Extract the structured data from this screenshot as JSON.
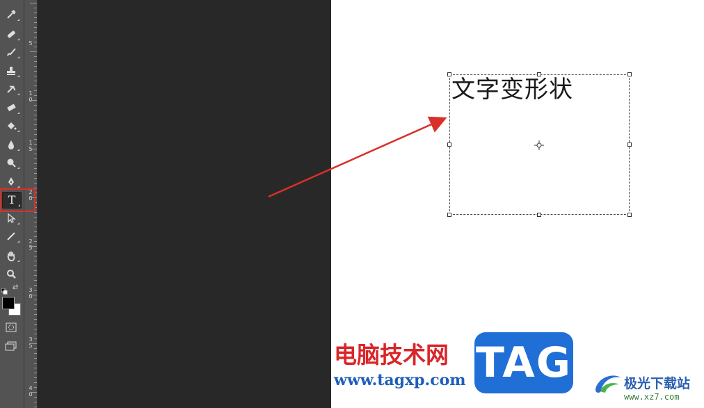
{
  "tools": [
    {
      "name": "eyedropper-tool",
      "icon": "eyedropper-icon",
      "glyph": "⁄"
    },
    {
      "name": "healing-brush-tool",
      "icon": "bandage-icon",
      "glyph": "✚"
    },
    {
      "name": "brush-tool",
      "icon": "brush-icon",
      "glyph": "╱"
    },
    {
      "name": "clone-stamp-tool",
      "icon": "stamp-icon",
      "glyph": "⊥"
    },
    {
      "name": "history-brush-tool",
      "icon": "history-brush-icon",
      "glyph": "↺"
    },
    {
      "name": "eraser-tool",
      "icon": "eraser-icon",
      "glyph": "▰"
    },
    {
      "name": "paint-bucket-tool",
      "icon": "paint-bucket-icon",
      "glyph": "◈"
    },
    {
      "name": "blur-tool",
      "icon": "droplet-icon",
      "glyph": "●"
    },
    {
      "name": "dodge-tool",
      "icon": "dodge-icon",
      "glyph": "⚲"
    },
    {
      "name": "pen-tool",
      "icon": "pen-icon",
      "glyph": "✒"
    },
    {
      "name": "type-tool",
      "icon": "type-icon",
      "glyph": "T"
    },
    {
      "name": "path-selection-tool",
      "icon": "arrow-cursor-icon",
      "glyph": "➚"
    },
    {
      "name": "line-tool",
      "icon": "line-icon",
      "glyph": "╱"
    },
    {
      "name": "hand-tool",
      "icon": "hand-icon",
      "glyph": "✋"
    },
    {
      "name": "zoom-tool",
      "icon": "magnifier-icon",
      "glyph": "⚲"
    }
  ],
  "ruler_labels": [
    {
      "text": "5"
    },
    {
      "text": "1\n0"
    },
    {
      "text": "1\n5"
    },
    {
      "text": "2\n0"
    },
    {
      "text": "2\n5"
    },
    {
      "text": "3\n0"
    },
    {
      "text": "3\n5"
    },
    {
      "text": "4\n0"
    }
  ],
  "canvas": {
    "text": "文字变形状"
  },
  "watermark": {
    "site_name_cn": "电脑技术网",
    "site_url": "www.tagxp.com",
    "tag_label": "TAG",
    "partner_name": "极光下载站",
    "partner_url": "www.xz7.com"
  },
  "colors": {
    "foreground": "#000000",
    "background": "#ffffff",
    "highlight_border": "#d9302a",
    "annotation_arrow": "#d9302a"
  }
}
